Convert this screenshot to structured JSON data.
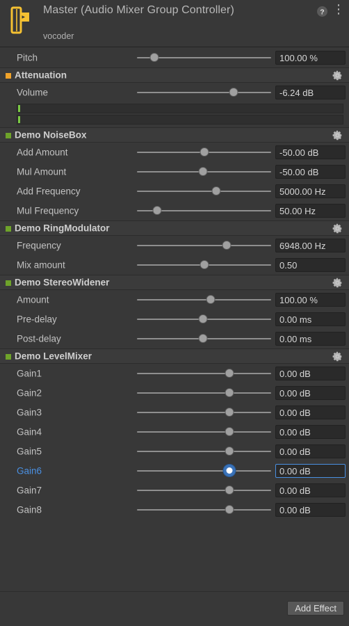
{
  "header": {
    "icon": "audio-mixer-group-icon",
    "title": "Master (Audio Mixer Group Controller)",
    "subtitle": "vocoder",
    "help_icon": "help-icon",
    "menu_icon": "kebab-menu-icon"
  },
  "colors": {
    "background": "#383838",
    "section_header_bg": "#3b3b3b",
    "swatch_attenuation": "#f0a32a",
    "swatch_effect": "#6ea32a",
    "focus_blue": "#4a90e2",
    "meter_green": "#7ac943",
    "icon_yellow": "#f5c132"
  },
  "pitch": {
    "label": "Pitch",
    "value": "100.00 %",
    "slider_pct": 13
  },
  "sections": [
    {
      "name": "Attenuation",
      "swatch": "#f0a32a",
      "gear_icon": "gear-icon",
      "rows": [
        {
          "label": "Volume",
          "value": "-6.24 dB",
          "slider_pct": 72,
          "focused": false
        }
      ],
      "meters": [
        {
          "level_pct": 2
        },
        {
          "level_pct": 2
        }
      ]
    },
    {
      "name": "Demo NoiseBox",
      "swatch": "#6ea32a",
      "gear_icon": "gear-icon",
      "rows": [
        {
          "label": "Add Amount",
          "value": "-50.00 dB",
          "slider_pct": 50,
          "focused": false
        },
        {
          "label": "Mul Amount",
          "value": "-50.00 dB",
          "slider_pct": 49,
          "focused": false
        },
        {
          "label": "Add Frequency",
          "value": "5000.00 Hz",
          "slider_pct": 59,
          "focused": false
        },
        {
          "label": "Mul Frequency",
          "value": "50.00 Hz",
          "slider_pct": 15,
          "focused": false
        }
      ],
      "meters": []
    },
    {
      "name": "Demo RingModulator",
      "swatch": "#6ea32a",
      "gear_icon": "gear-icon",
      "rows": [
        {
          "label": "Frequency",
          "value": "6948.00 Hz",
          "slider_pct": 67,
          "focused": false
        },
        {
          "label": "Mix amount",
          "value": "0.50",
          "slider_pct": 50,
          "focused": false
        }
      ],
      "meters": []
    },
    {
      "name": "Demo StereoWidener",
      "swatch": "#6ea32a",
      "gear_icon": "gear-icon",
      "rows": [
        {
          "label": "Amount",
          "value": "100.00 %",
          "slider_pct": 55,
          "focused": false
        },
        {
          "label": "Pre-delay",
          "value": "0.00 ms",
          "slider_pct": 49,
          "focused": false
        },
        {
          "label": "Post-delay",
          "value": "0.00 ms",
          "slider_pct": 49,
          "focused": false
        }
      ],
      "meters": []
    },
    {
      "name": "Demo LevelMixer",
      "swatch": "#6ea32a",
      "gear_icon": "gear-icon",
      "rows": [
        {
          "label": "Gain1",
          "value": "0.00 dB",
          "slider_pct": 69,
          "focused": false
        },
        {
          "label": "Gain2",
          "value": "0.00 dB",
          "slider_pct": 69,
          "focused": false
        },
        {
          "label": "Gain3",
          "value": "0.00 dB",
          "slider_pct": 69,
          "focused": false
        },
        {
          "label": "Gain4",
          "value": "0.00 dB",
          "slider_pct": 69,
          "focused": false
        },
        {
          "label": "Gain5",
          "value": "0.00 dB",
          "slider_pct": 69,
          "focused": false
        },
        {
          "label": "Gain6",
          "value": "0.00 dB",
          "slider_pct": 69,
          "focused": true
        },
        {
          "label": "Gain7",
          "value": "0.00 dB",
          "slider_pct": 69,
          "focused": false
        },
        {
          "label": "Gain8",
          "value": "0.00 dB",
          "slider_pct": 69,
          "focused": false
        }
      ],
      "meters": []
    }
  ],
  "footer": {
    "add_effect_label": "Add Effect"
  }
}
